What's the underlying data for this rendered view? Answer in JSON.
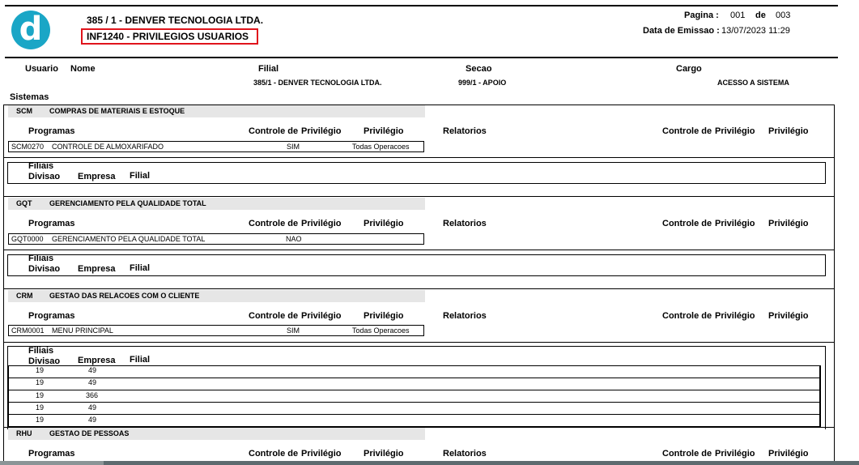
{
  "header": {
    "company": "385 / 1 - DENVER TECNOLOGIA LTDA.",
    "report": "INF1240 - PRIVILEGIOS USUARIOS",
    "pagina_label": "Pagina :",
    "pagina_num": "001",
    "pagina_de": "de",
    "pagina_total": "003",
    "emissao_label": "Data de Emissao :",
    "emissao_value": "13/07/2023 11:29",
    "logo_letter": "d"
  },
  "columns": {
    "usuario": "Usuario",
    "nome": "Nome",
    "filial": "Filial",
    "secao": "Secao",
    "cargo": "Cargo"
  },
  "user": {
    "filial": "385/1 - DENVER TECNOLOGIA LTDA.",
    "secao": "999/1 - APOIO",
    "cargo": "ACESSO A SISTEMA"
  },
  "sistemas_label": "Sistemas",
  "labels": {
    "programas": "Programas",
    "controle_de": "Controle de",
    "privilegio": "Privilégio",
    "relatorios": "Relatorios",
    "filiais": "Filiais",
    "divisao": "Divisao",
    "empresa": "Empresa",
    "filial": "Filial"
  },
  "systems": [
    {
      "code": "SCM",
      "name": "COMPRAS DE MATERIAIS E ESTOQUE",
      "program": {
        "code": "SCM0270",
        "name": "CONTROLE DE ALMOXARIFADO",
        "controle": "SIM",
        "privilegio": "Todas Operacoes"
      }
    },
    {
      "code": "GQT",
      "name": "GERENCIAMENTO PELA QUALIDADE TOTAL",
      "program": {
        "code": "GQT0000",
        "name": "GERENCIAMENTO PELA QUALIDADE TOTAL",
        "controle": "NAO",
        "privilegio": ""
      }
    },
    {
      "code": "CRM",
      "name": "GESTAO DAS RELACOES COM O CLIENTE",
      "program": {
        "code": "CRM0001",
        "name": "MENU PRINCIPAL",
        "controle": "SIM",
        "privilegio": "Todas Operacoes"
      },
      "filiais": [
        {
          "divisao": "19",
          "empresa": "49"
        },
        {
          "divisao": "19",
          "empresa": "49"
        },
        {
          "divisao": "19",
          "empresa": "366"
        },
        {
          "divisao": "19",
          "empresa": "49"
        },
        {
          "divisao": "19",
          "empresa": "49"
        }
      ]
    },
    {
      "code": "RHU",
      "name": "GESTAO DE PESSOAS"
    }
  ]
}
